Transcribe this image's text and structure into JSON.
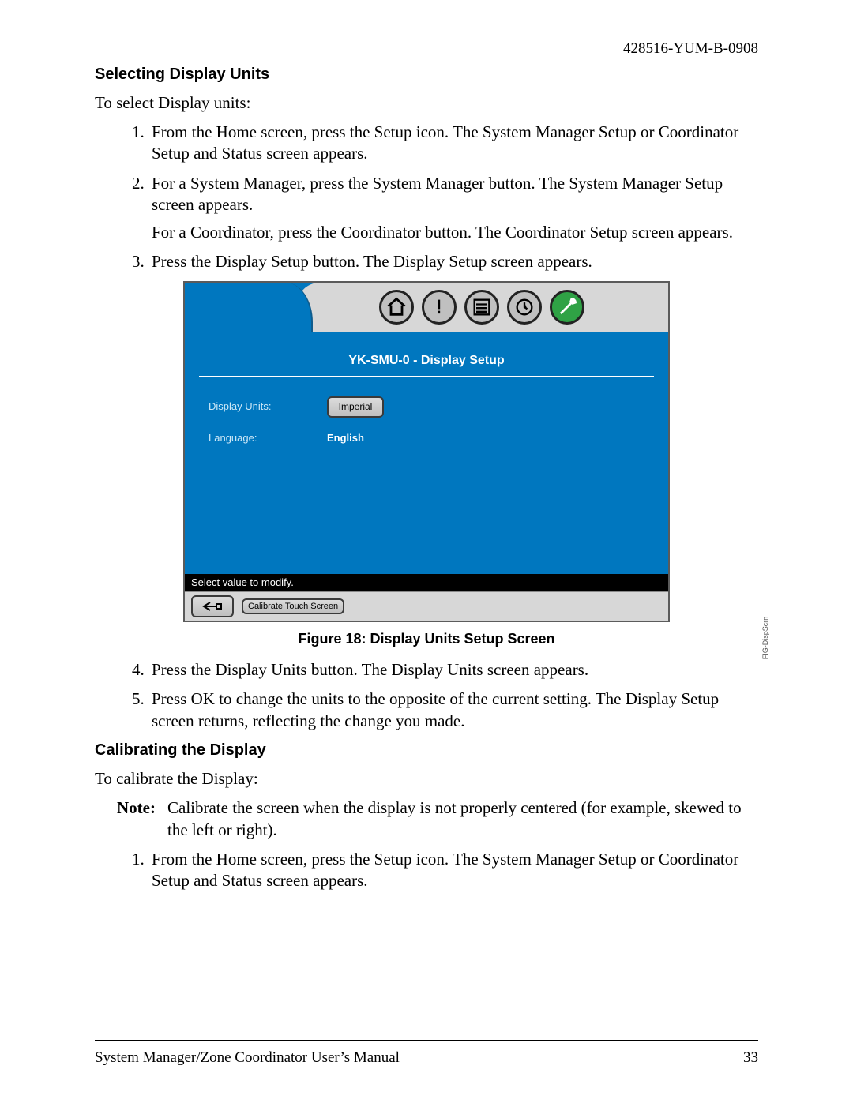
{
  "header": {
    "doc_id": "428516-YUM-B-0908"
  },
  "section1": {
    "heading": "Selecting Display Units",
    "intro": "To select Display units:",
    "steps": {
      "s1": "From the Home screen, press the Setup icon. The System Manager Setup or Coordinator Setup and Status screen appears.",
      "s2a": "For a System Manager, press the System Manager button. The System Manager Setup screen appears.",
      "s2b": "For a Coordinator, press the Coordinator button. The Coordinator Setup screen appears.",
      "s3": "Press the Display Setup button. The Display Setup screen appears."
    }
  },
  "figure": {
    "caption": "Figure 18: Display Units Setup Screen",
    "side_label": "FIG-DispScrn",
    "screen_title": "YK-SMU-0 - Display Setup",
    "display_units_label": "Display Units:",
    "display_units_value": "Imperial",
    "language_label": "Language:",
    "language_value": "English",
    "status_text": "Select value to modify.",
    "calibrate_button": "Calibrate Touch Screen"
  },
  "section1b": {
    "s4": "Press the Display Units button. The Display Units screen appears.",
    "s5": "Press OK to change the units to the opposite of the current setting. The Display Setup screen returns, reflecting the change you made."
  },
  "section2": {
    "heading": "Calibrating the Display",
    "intro": "To calibrate the Display:",
    "note_label": "Note:",
    "note_text": "Calibrate the screen when the display is not properly centered (for example, skewed to the left or right).",
    "s1": "From the Home screen, press the Setup icon. The System Manager Setup or Coordinator Setup and Status screen appears."
  },
  "footer": {
    "left": "System Manager/Zone Coordinator User’s Manual",
    "right": "33"
  }
}
